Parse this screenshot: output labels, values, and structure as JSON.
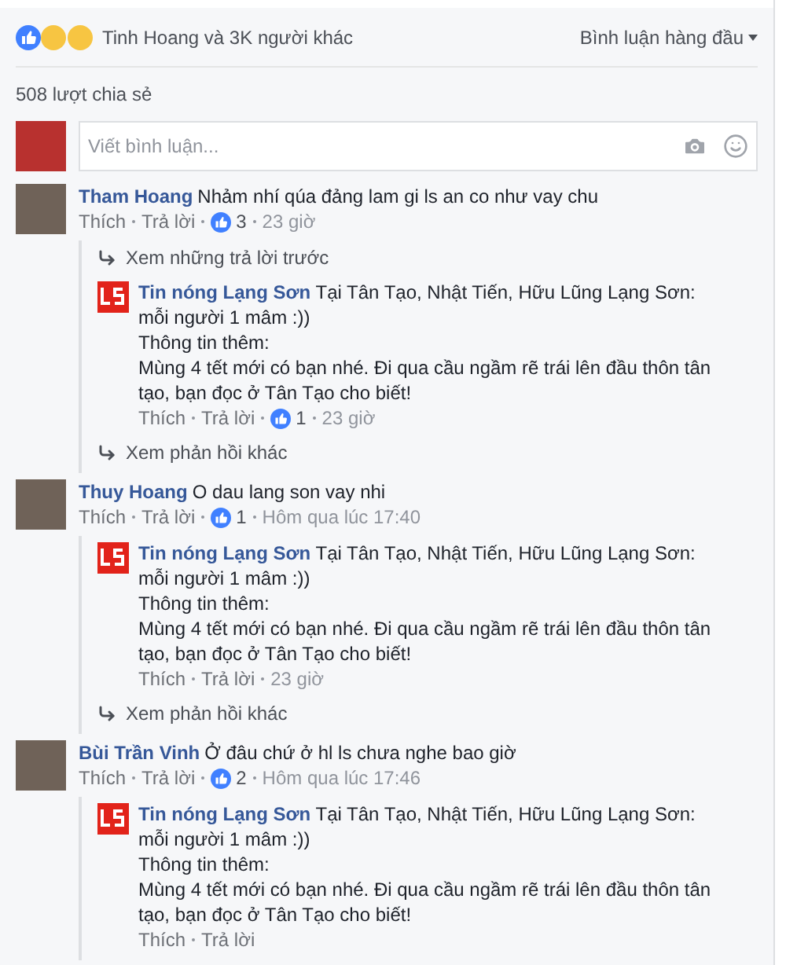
{
  "reactions": {
    "summary": "Tinh Hoang và 3K người khác"
  },
  "sort": {
    "label": "Bình luận hàng đầu"
  },
  "shares": "508 lượt chia sẻ",
  "composer": {
    "placeholder": "Viết bình luận..."
  },
  "comments": [
    {
      "author": "Tham Hoang",
      "text": "Nhảm nhí qúa đảng lam gi ls an co như vay chu",
      "actions": [
        "Thích",
        "Trả lời"
      ],
      "likes": "3",
      "time": "23 giờ",
      "previous": "Xem những trả lời trước",
      "replies": [
        {
          "lines": [
            "**Tin nóng Lạng Sơn** Tại Tân Tạo, Nhật Tiến, Hữu Lũng Lạng Sơn: mỗi người 1 mâm :))",
            "Thông tin thêm:",
            "Mùng 4 tết mới có bạn nhé. Đi qua cầu ngầm rẽ trái lên đầu thôn tân tạo, bạn đọc ở Tân Tạo cho biết!"
          ],
          "actions": [
            "Thích",
            "Trả lời"
          ],
          "likes": "1",
          "time": "23 giờ"
        }
      ],
      "more": "Xem phản hồi khác"
    },
    {
      "author": "Thuy Hoang",
      "text": "O dau lang son vay nhi",
      "actions": [
        "Thích",
        "Trả lời"
      ],
      "likes": "1",
      "time": "Hôm qua lúc 17:40",
      "replies": [
        {
          "lines": [
            "**Tin nóng Lạng Sơn** Tại Tân Tạo, Nhật Tiến, Hữu Lũng Lạng Sơn: mỗi người 1 mâm :))",
            "Thông tin thêm:",
            "Mùng 4 tết mới có bạn nhé. Đi qua cầu ngầm rẽ trái lên đầu thôn tân tạo, bạn đọc ở Tân Tạo cho biết!"
          ],
          "actions": [
            "Thích",
            "Trả lời"
          ],
          "time": "23 giờ"
        }
      ],
      "more": "Xem phản hồi khác"
    },
    {
      "author": "Bùi Trần Vinh",
      "text": "Ở đâu chứ ở hl ls chưa nghe bao giờ",
      "actions": [
        "Thích",
        "Trả lời"
      ],
      "likes": "2",
      "time": "Hôm qua lúc 17:46",
      "replies": [
        {
          "lines": [
            "**Tin nóng Lạng Sơn** Tại Tân Tạo, Nhật Tiến, Hữu Lũng Lạng Sơn: mỗi người 1 mâm :))",
            "Thông tin thêm:",
            "Mùng 4 tết mới có bạn nhé. Đi qua cầu ngầm rẽ trái lên đầu thôn tân tạo, bạn đọc ở Tân Tạo cho biết!"
          ],
          "actions": [
            "Thích",
            "Trả lời"
          ]
        }
      ]
    }
  ]
}
